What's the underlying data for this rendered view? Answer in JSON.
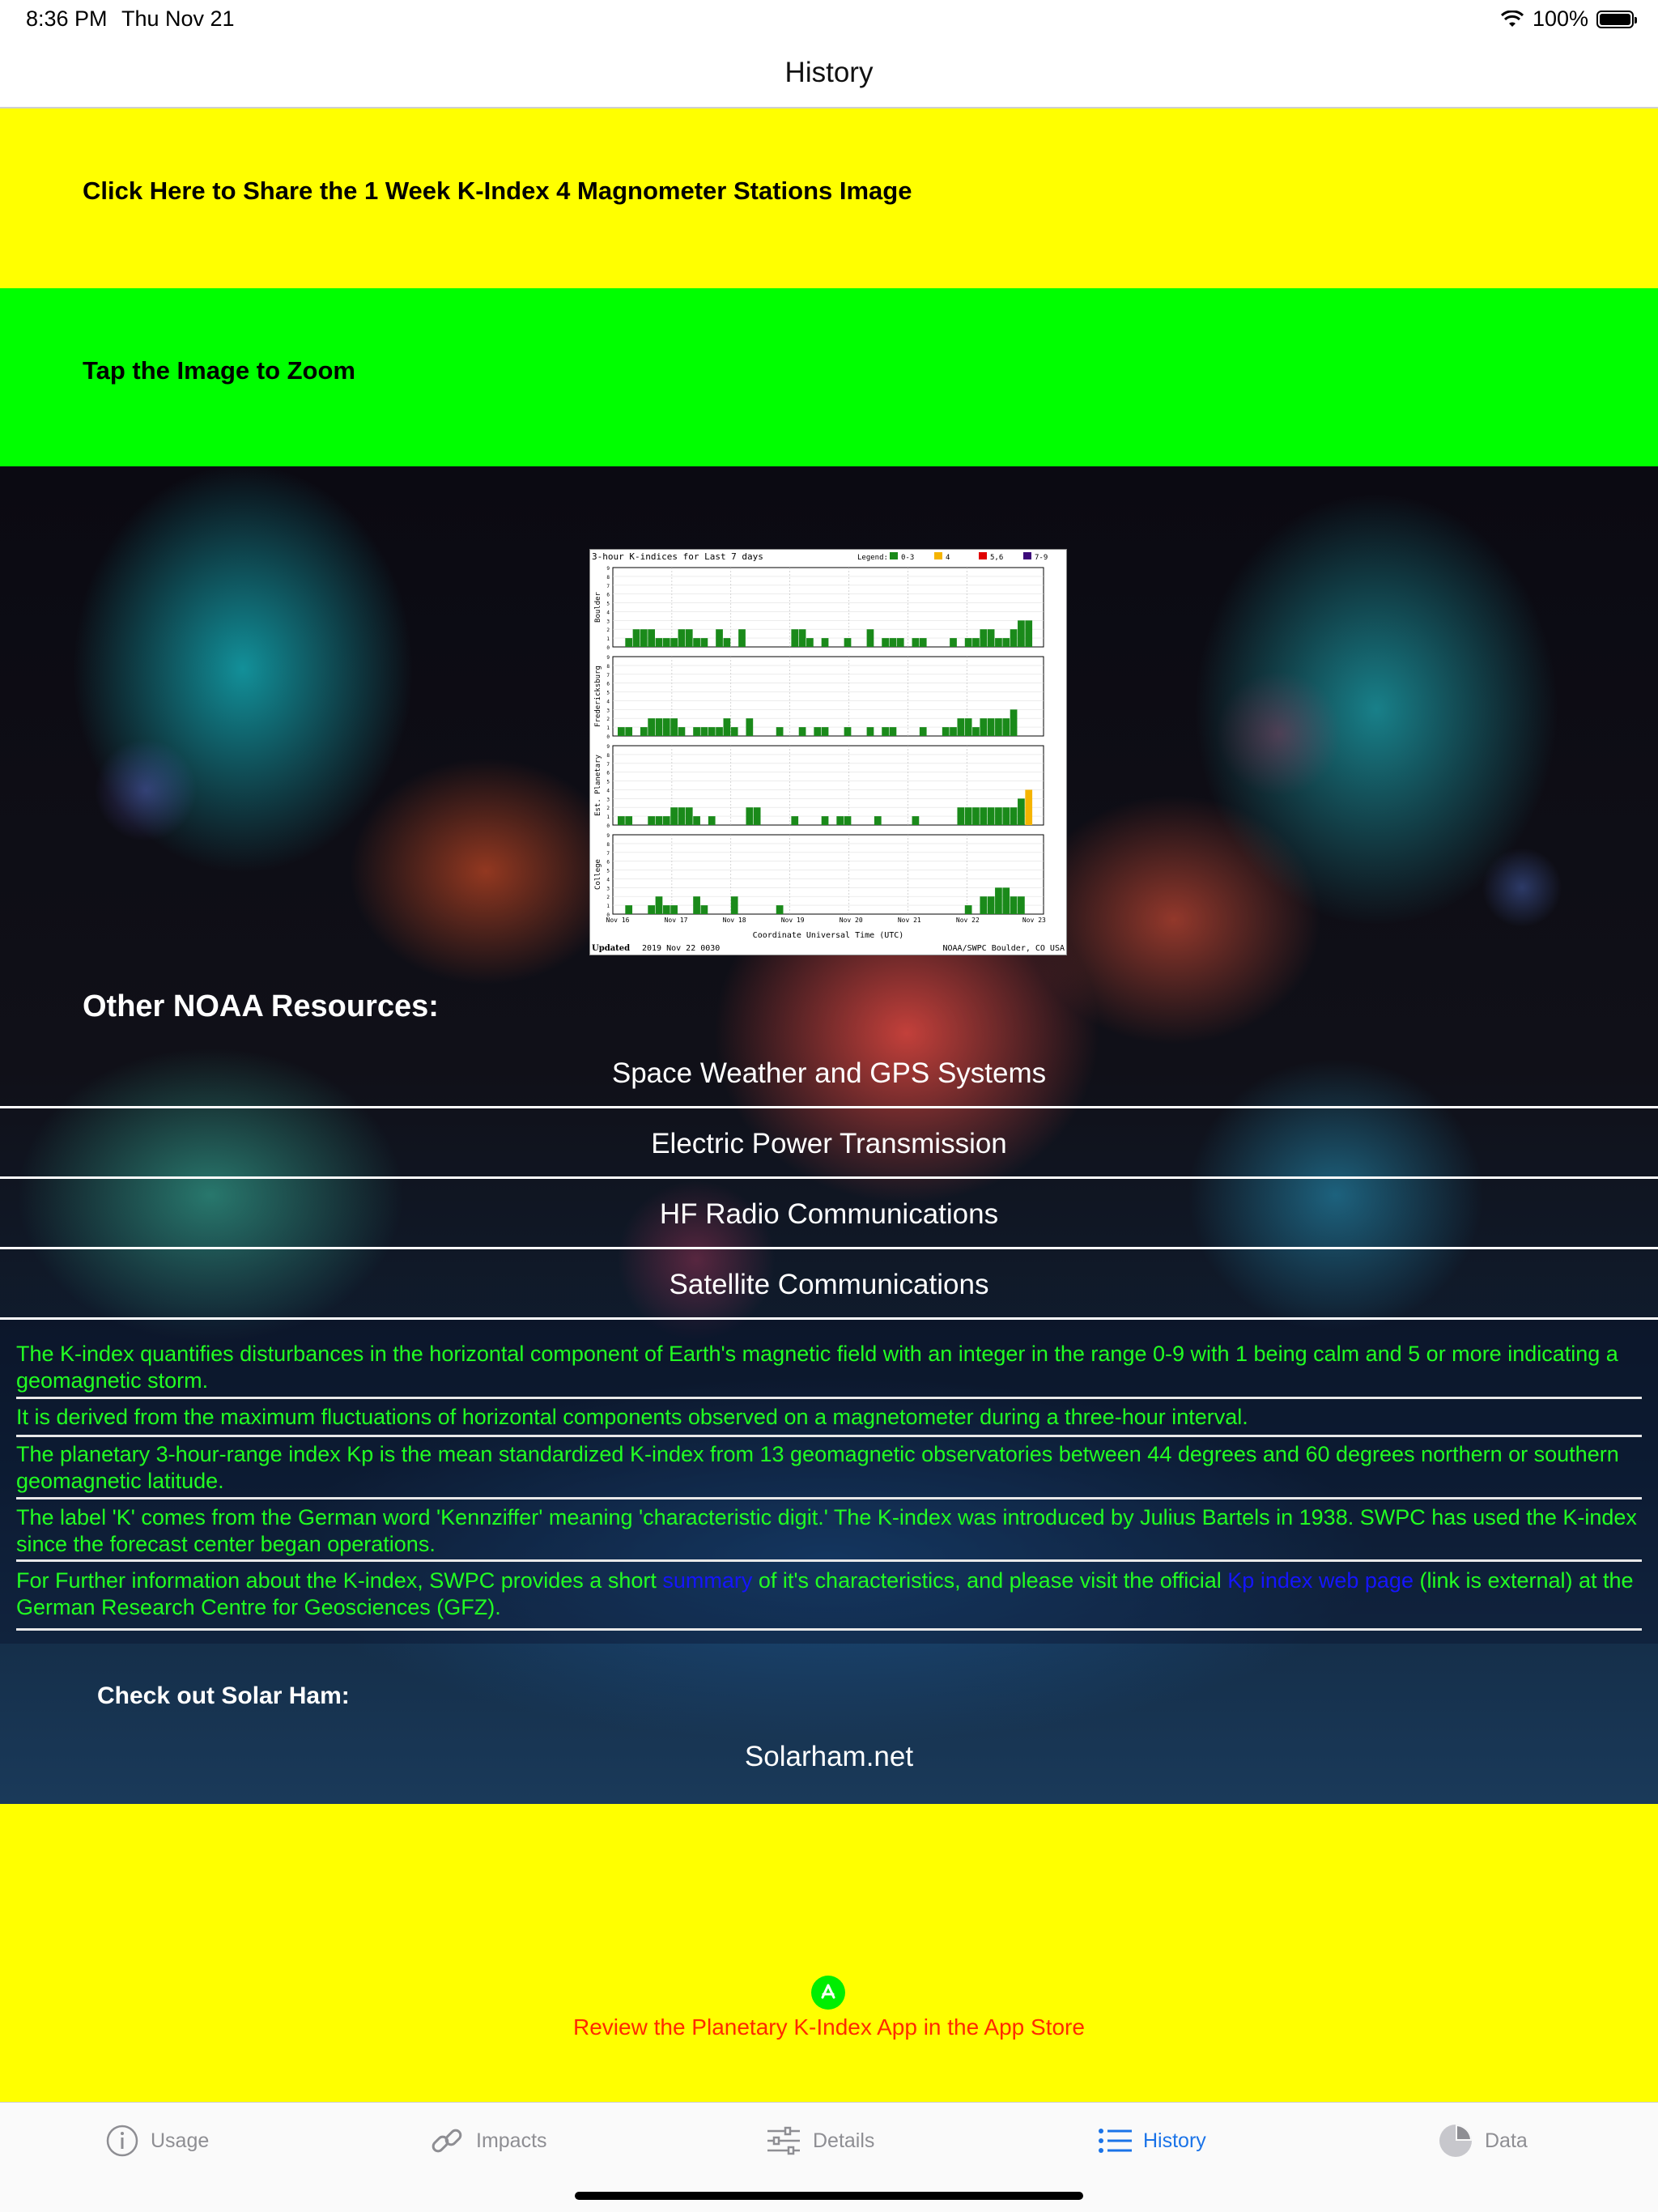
{
  "status_bar": {
    "time": "8:36 PM",
    "date": "Thu Nov 21",
    "battery": "100%"
  },
  "nav": {
    "title": "History"
  },
  "share_band": {
    "label": "Click Here to Share the 1 Week K-Index 4 Magnometer Stations Image"
  },
  "zoom_band": {
    "label": "Tap the Image to Zoom"
  },
  "kindex_image": {
    "title": "3-hour K-indices for Last 7 days",
    "legend_label": "Legend:",
    "legend": [
      {
        "label": "0-3",
        "color": "#1a8a1a"
      },
      {
        "label": "4",
        "color": "#f5b400"
      },
      {
        "label": "5,6",
        "color": "#e00000"
      },
      {
        "label": "7-9",
        "color": "#3c0a7a"
      }
    ],
    "stations": [
      "Boulder",
      "Fredericksburg",
      "Est. Planetary",
      "College"
    ],
    "x_ticks": [
      "Nov 16",
      "Nov 17",
      "Nov 18",
      "Nov 19",
      "Nov 20",
      "Nov 21",
      "Nov 22",
      "Nov 23"
    ],
    "xlabel": "Coordinate Universal Time (UTC)",
    "updated_label": "Updated",
    "updated": "2019 Nov 22 0030",
    "source": "NOAA/SWPC Boulder, CO USA"
  },
  "resources": {
    "heading": "Other NOAA Resources:",
    "links": [
      "Space Weather and GPS Systems",
      "Electric Power Transmission",
      "HF Radio Communications",
      "Satellite Communications"
    ]
  },
  "info": {
    "p1": "The K-index quantifies disturbances in the horizontal component of Earth's magnetic field with an integer in the range 0-9 with 1 being calm and 5 or more indicating a geomagnetic storm.",
    "p2": "It is derived from the maximum fluctuations of horizontal components observed on a magnetometer during a three-hour interval.",
    "p3": "The planetary 3-hour-range index Kp is the mean standardized K-index from 13 geomagnetic observatories between 44 degrees and 60 degrees northern or southern geomagnetic latitude.",
    "p4": "The label 'K' comes from the German word 'Kennziffer' meaning 'characteristic digit.' The K-index was introduced by Julius Bartels in 1938. SWPC has used the K-index since the forecast center began operations.",
    "p5_a": "For Further information about the K-index, SWPC provides a short ",
    "p5_link1": "summary",
    "p5_b": " of it's characteristics, and please visit the official ",
    "p5_link2": "Kp index web page",
    "p5_c": " (link is external) at the German Research Centre for Geosciences (GFZ)."
  },
  "solar_ham": {
    "label": "Check out Solar Ham:",
    "link": "Solarham.net"
  },
  "review": {
    "label": "Review the Planetary K-Index App in the App Store"
  },
  "tabs": [
    {
      "label": "Usage",
      "icon": "info-icon"
    },
    {
      "label": "Impacts",
      "icon": "link-icon"
    },
    {
      "label": "Details",
      "icon": "sliders-icon"
    },
    {
      "label": "History",
      "icon": "list-icon",
      "active": true
    },
    {
      "label": "Data",
      "icon": "pie-chart-icon"
    }
  ],
  "colors": {
    "yellow": "#ffff00",
    "green": "#00ff00",
    "info_text": "#22ff22",
    "review_text": "#ff2a00",
    "active_tab": "#1a73e8"
  }
}
